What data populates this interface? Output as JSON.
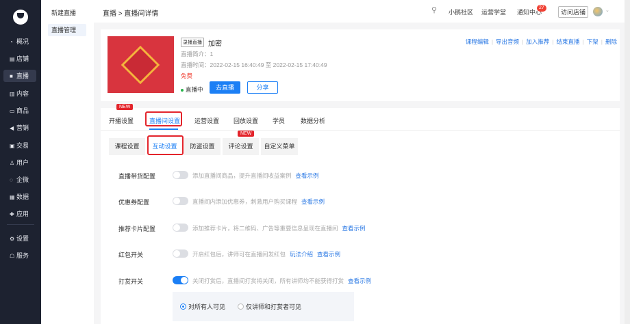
{
  "sidebar": {
    "items": [
      {
        "label": "概况",
        "icon": "◔"
      },
      {
        "label": "店铺",
        "icon": "▤"
      },
      {
        "label": "直播",
        "icon": "■"
      },
      {
        "label": "内容",
        "icon": "▥"
      },
      {
        "label": "商品",
        "icon": "▭"
      },
      {
        "label": "营销",
        "icon": "◀"
      },
      {
        "label": "交易",
        "icon": "▣"
      },
      {
        "label": "用户",
        "icon": "♙"
      },
      {
        "label": "企微",
        "icon": "◌"
      },
      {
        "label": "数据",
        "icon": "▦"
      },
      {
        "label": "应用",
        "icon": "✚"
      },
      {
        "label": "设置",
        "icon": "⚙"
      },
      {
        "label": "服务",
        "icon": "☖"
      }
    ]
  },
  "subnav": {
    "items": [
      "新建直播",
      "直播管理"
    ]
  },
  "header": {
    "breadcrumb": "直播 > 直播间详情",
    "links": [
      "小鹅社区",
      "运营学堂",
      "通知中心"
    ],
    "notify_count": "27",
    "visit": "访问店铺"
  },
  "live": {
    "tag": "录播直播",
    "title": "加密",
    "intro": "直播简介：1",
    "time": "直播时间：2022-02-15 16:40:49 至 2022-02-15 17:40:49",
    "price": "免费",
    "status": "直播中",
    "go": "去直播",
    "share": "分享",
    "actions": [
      "课程编辑",
      "导出音频",
      "加入推荐",
      "结束直播",
      "下架",
      "删除"
    ]
  },
  "tabs": [
    "开播设置",
    "直播间设置",
    "运营设置",
    "回放设置",
    "学员",
    "数据分析"
  ],
  "new_label": "NEW",
  "subtabs": [
    "课程设置",
    "互动设置",
    "防盗设置",
    "评论设置",
    "自定义菜单"
  ],
  "settings": [
    {
      "label": "直播带货配置",
      "on": false,
      "desc": "添加直播间商品，提升直播间收益案例",
      "links": [
        "查看示例"
      ]
    },
    {
      "label": "优惠券配置",
      "on": false,
      "desc": "直播间内添加优惠券，刺激用户购买课程",
      "links": [
        "查看示例"
      ]
    },
    {
      "label": "推荐卡片配置",
      "on": false,
      "desc": "添加推荐卡片，将二维码、广告等重要信息呈现在直播间",
      "links": [
        "查看示例"
      ]
    },
    {
      "label": "红包开关",
      "on": false,
      "desc": "开启红包后，讲师可在直播间发红包",
      "links": [
        "玩法介绍",
        "查看示例"
      ]
    },
    {
      "label": "打赏开关",
      "on": true,
      "desc": "关闭打赏后，直播间打赏将关闭，所有讲师均不能获得打赏",
      "links": [
        "查看示例"
      ]
    }
  ],
  "reward_visibility": {
    "options": [
      "对所有人可见",
      "仅讲师和打赏者可见"
    ],
    "selected": 0
  }
}
